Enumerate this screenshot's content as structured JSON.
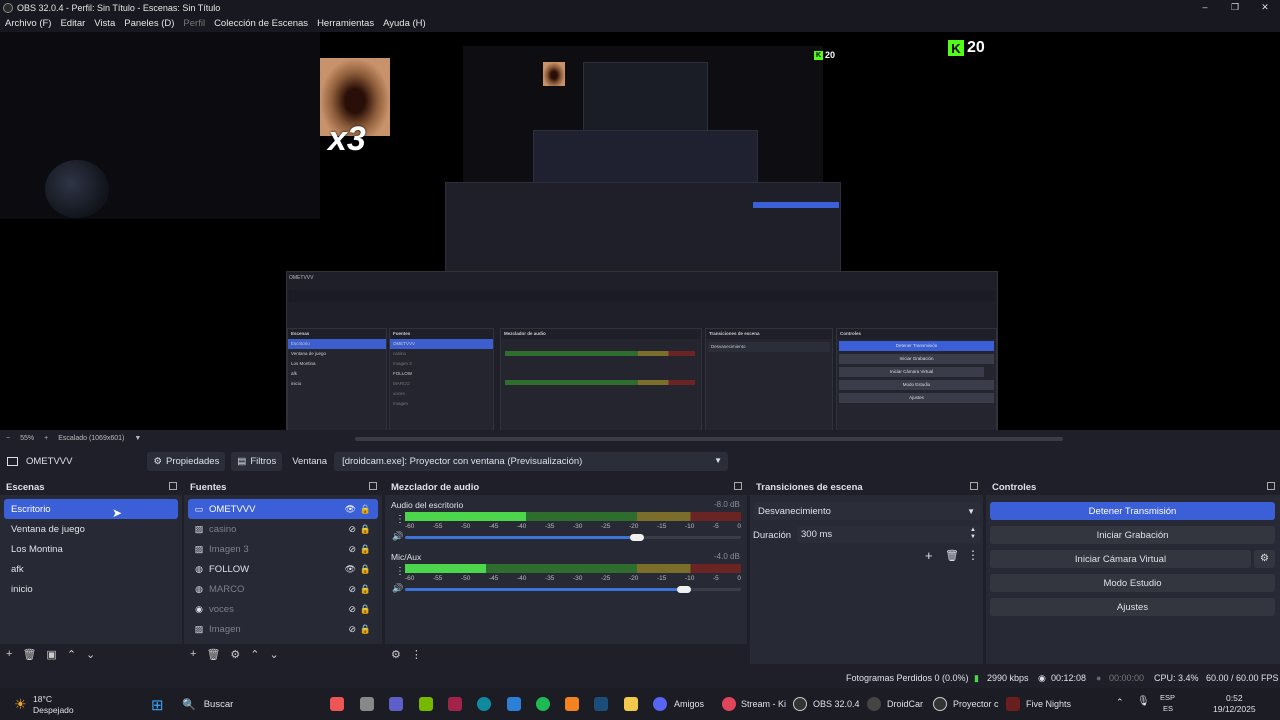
{
  "window": {
    "title": "OBS 32.0.4 - Perfil: Sin Título - Escenas: Sin Título",
    "controls": [
      "–",
      "❐",
      "✕"
    ]
  },
  "menu": [
    "Archivo (F)",
    "Editar",
    "Vista",
    "Paneles (D)",
    "Perfil",
    "Colección de Escenas",
    "Herramientas",
    "Ayuda (H)"
  ],
  "preview": {
    "overlay_x3": "x3",
    "kick_counter": "20",
    "nested": {
      "scenes": [
        "Escritorio",
        "Ventana de juego",
        "Los Montina",
        "afk",
        "inicio"
      ],
      "sources": [
        "OMETVVV",
        "casino",
        "Imagen 3",
        "FOLLOW",
        "MARCO",
        "voces",
        "Imagen"
      ],
      "controls": [
        "Detener Transmisión",
        "Iniciar Grabación",
        "Iniciar Cámara Virtual",
        "Modo Estudio",
        "Ajustes"
      ],
      "scene_label": "Escenas",
      "sources_label": "Fuentes",
      "mixer_label": "Mezclador de audio",
      "transitions_label": "Transiciones de escena",
      "controls_label": "Controles"
    }
  },
  "zoom": {
    "minus": "−",
    "value": "55%",
    "plus": "+",
    "scaling": "Escalado (1069x601)"
  },
  "source_toolbar": {
    "source_name": "OMETVVV",
    "properties": "Propiedades",
    "filters": "Filtros",
    "window_label": "Ventana",
    "window_value": "[droidcam.exe]: Proyector con ventana (Previsualización)"
  },
  "scenes": {
    "title": "Escenas",
    "items": [
      "Escritorio",
      "Ventana de juego",
      "Los Montina",
      "afk",
      "inicio"
    ],
    "selected": 0
  },
  "sources": {
    "title": "Fuentes",
    "items": [
      {
        "name": "OMETVVV",
        "icon": "window-icon",
        "visible": true
      },
      {
        "name": "casino",
        "icon": "image-icon",
        "visible": false
      },
      {
        "name": "Imagen 3",
        "icon": "image-icon",
        "visible": false
      },
      {
        "name": "FOLLOW",
        "icon": "browser-icon",
        "visible": true
      },
      {
        "name": "MARCO",
        "icon": "browser-icon",
        "visible": false
      },
      {
        "name": "voces",
        "icon": "audio-icon",
        "visible": false
      },
      {
        "name": "Imagen",
        "icon": "image-icon",
        "visible": false
      }
    ]
  },
  "mixer": {
    "title": "Mezclador de audio",
    "channels": [
      {
        "name": "Audio del escritorio",
        "db": "-8.0 dB",
        "level": 0.36,
        "volume": 0.69
      },
      {
        "name": "Mic/Aux",
        "db": "-4.0 dB",
        "level": 0.24,
        "volume": 0.83
      }
    ],
    "scale": [
      "-60",
      "-55",
      "-50",
      "-45",
      "-40",
      "-35",
      "-30",
      "-25",
      "-20",
      "-15",
      "-10",
      "-5",
      "0"
    ]
  },
  "transitions": {
    "title": "Transiciones de escena",
    "selected": "Desvanecimiento",
    "duration_label": "Duración",
    "duration_value": "300 ms"
  },
  "controls": {
    "title": "Controles",
    "stop_stream": "Detener Transmisión",
    "start_recording": "Iniciar Grabación",
    "start_virtual_cam": "Iniciar Cámara Virtual",
    "studio_mode": "Modo Estudio",
    "settings": "Ajustes"
  },
  "status": {
    "dropped_frames": "Fotogramas Perdidos 0 (0.0%)",
    "bitrate": "2990 kbps",
    "stream_time": "00:12:08",
    "rec_time": "00:00:00",
    "cpu": "CPU: 3.4%",
    "fps": "60.00 / 60.00 FPS"
  },
  "taskbar": {
    "weather_temp": "18°C",
    "weather_desc": "Despejado",
    "search": "Buscar",
    "apps": [
      "Amigos",
      "Stream - Ki",
      "OBS 32.0.4",
      "DroidCar",
      "Proyector c",
      "Five Nights"
    ],
    "lang1": "ESP",
    "lang2": "ES",
    "time": "0:52",
    "date": "19/12/2025"
  },
  "colors": {
    "accent": "#3b5fd6",
    "kick_green": "#53fc18",
    "background": "#1e1f29",
    "panel": "#272934"
  }
}
